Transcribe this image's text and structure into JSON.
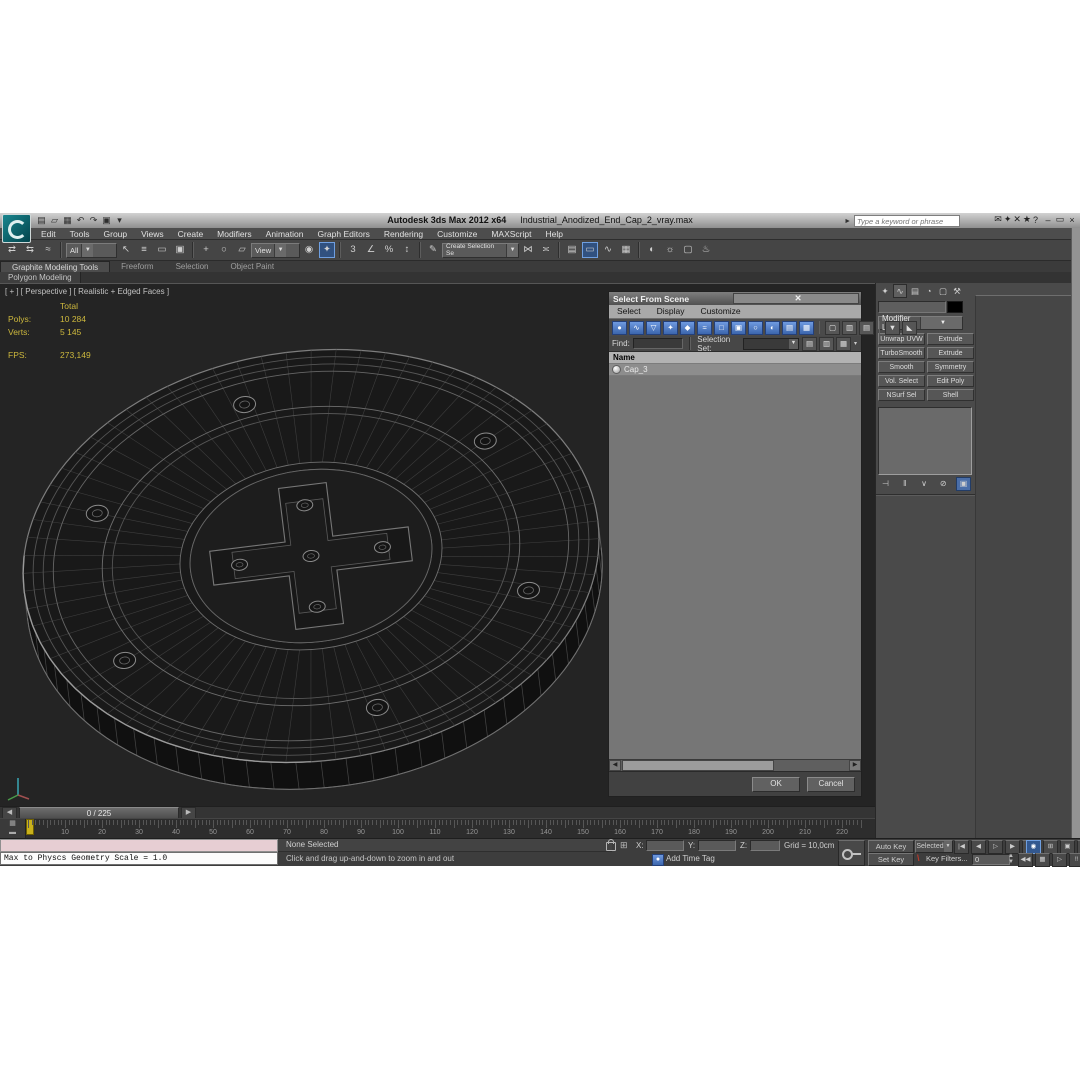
{
  "window": {
    "app_title": "Autodesk 3ds Max  2012 x64",
    "file_title": "Industrial_Anodized_End_Cap_2_vray.max",
    "search_placeholder": "Type a keyword or phrase"
  },
  "menubar": {
    "items": [
      "Edit",
      "Tools",
      "Group",
      "Views",
      "Create",
      "Modifiers",
      "Animation",
      "Graph Editors",
      "Rendering",
      "Customize",
      "MAXScript",
      "Help"
    ]
  },
  "toolbar": {
    "selection_filter": "All",
    "coord_system": "View",
    "named_sets": "Create Selection Se",
    "groups": [
      [
        {
          "n": "select-and-link-icon",
          "g": "⇄"
        },
        {
          "n": "unlink-selection-icon",
          "g": "⇆"
        },
        {
          "n": "bind-spacewarp-icon",
          "g": "≈"
        }
      ],
      [
        {
          "n": "select-object-icon",
          "g": "↖"
        },
        {
          "n": "select-by-name-icon",
          "g": "≡"
        },
        {
          "n": "rect-region-icon",
          "g": "▭"
        },
        {
          "n": "window-crossing-icon",
          "g": "▣"
        }
      ],
      [
        {
          "n": "select-move-icon",
          "g": "+"
        },
        {
          "n": "select-rotate-icon",
          "g": "○"
        },
        {
          "n": "select-scale-icon",
          "g": "▱"
        }
      ],
      [
        {
          "n": "use-center-icon",
          "g": "◉"
        },
        {
          "n": "select-manipulate-icon",
          "g": "✦",
          "active": true
        }
      ],
      [
        {
          "n": "snap-3d-icon",
          "g": "3"
        },
        {
          "n": "angle-snap-icon",
          "g": "∠"
        },
        {
          "n": "percent-snap-icon",
          "g": "%"
        },
        {
          "n": "spinner-snap-icon",
          "g": "↕"
        }
      ],
      [
        {
          "n": "edit-named-sets-icon",
          "g": "✎"
        }
      ],
      [
        {
          "n": "mirror-icon",
          "g": "⋈"
        },
        {
          "n": "align-icon",
          "g": "≍"
        }
      ],
      [
        {
          "n": "layer-manager-icon",
          "g": "▤"
        },
        {
          "n": "ribbon-toggle-icon",
          "g": "▭",
          "active": true
        },
        {
          "n": "curve-editor-icon",
          "g": "∿"
        },
        {
          "n": "schematic-view-icon",
          "g": "▦"
        }
      ],
      [
        {
          "n": "material-editor-icon",
          "g": "◐"
        },
        {
          "n": "render-setup-icon",
          "g": "☼"
        },
        {
          "n": "rendered-frame-icon",
          "g": "▢"
        },
        {
          "n": "render-production-icon",
          "g": "♨"
        }
      ]
    ],
    "qat_icons": [
      {
        "n": "new-scene-icon",
        "g": "▤"
      },
      {
        "n": "open-file-icon",
        "g": "▱"
      },
      {
        "n": "save-file-icon",
        "g": "▦"
      },
      {
        "n": "undo-icon",
        "g": "↶"
      },
      {
        "n": "redo-icon",
        "g": "↷"
      },
      {
        "n": "project-folder-icon",
        "g": "▣"
      },
      {
        "n": "qat-dropdown-icon",
        "g": "▾"
      }
    ],
    "search_icons": [
      {
        "n": "communication-center-icon",
        "g": "✉"
      },
      {
        "n": "wrench-icon",
        "g": "✦"
      },
      {
        "n": "sign-in-icon",
        "g": "✕"
      },
      {
        "n": "favorites-star-icon",
        "g": "★"
      },
      {
        "n": "help-icon",
        "g": "?"
      }
    ],
    "window_icons": [
      {
        "n": "minimize-icon",
        "g": "–"
      },
      {
        "n": "restore-icon",
        "g": "▭"
      },
      {
        "n": "close-icon",
        "g": "×"
      }
    ]
  },
  "ribbon": {
    "tabs": [
      "Graphite Modeling Tools",
      "Freeform",
      "Selection",
      "Object Paint"
    ],
    "active_tab": "Graphite Modeling Tools",
    "subtab": "Polygon Modeling",
    "collapse_icon": "▾"
  },
  "viewport": {
    "label": "[ + ] [ Perspective ] [ Realistic + Edged Faces ]",
    "stats": {
      "total": "Total",
      "polys_label": "Polys:",
      "polys": "10 284",
      "verts_label": "Verts:",
      "verts": "5 145",
      "fps_label": "FPS:",
      "fps": "273,149"
    }
  },
  "scene_dialog": {
    "title": "Select From Scene",
    "menus": [
      "Select",
      "Display",
      "Customize"
    ],
    "filter_icons": [
      {
        "n": "display-geometry-icon",
        "g": "●"
      },
      {
        "n": "display-shapes-icon",
        "g": "∿"
      },
      {
        "n": "display-lights-icon",
        "g": "▽"
      },
      {
        "n": "display-cameras-icon",
        "g": "✦"
      },
      {
        "n": "display-helpers-icon",
        "g": "◆"
      },
      {
        "n": "display-spacewarps-icon",
        "g": "≈"
      },
      {
        "n": "display-groups-icon",
        "g": "□"
      },
      {
        "n": "display-xrefs-icon",
        "g": "▣"
      },
      {
        "n": "display-bones-icon",
        "g": "○"
      },
      {
        "n": "display-containers-icon",
        "g": "◐"
      },
      {
        "n": "display-frozen-icon",
        "g": "▤"
      },
      {
        "n": "display-hidden-icon",
        "g": "▦"
      }
    ],
    "extra_icons": [
      {
        "n": "display-children-icon",
        "g": "▢"
      },
      {
        "n": "display-influences-icon",
        "g": "▥"
      },
      {
        "n": "display-dependents-icon",
        "g": "▤"
      }
    ],
    "funnel_icons": [
      {
        "n": "filter-icon",
        "g": "▼"
      },
      {
        "n": "filter-combinations-icon",
        "g": "◣"
      }
    ],
    "find_label": "Find:",
    "selection_set_label": "Selection Set:",
    "set_icons": [
      {
        "n": "create-set-icon",
        "g": "▤"
      },
      {
        "n": "add-to-set-icon",
        "g": "▥"
      },
      {
        "n": "subtract-set-icon",
        "g": "▦"
      }
    ],
    "expand_icon": "▾",
    "name_header": "Name",
    "rows": [
      {
        "label": "Cap_3"
      }
    ],
    "ok": "OK",
    "cancel": "Cancel",
    "hscroll_left": "◀",
    "hscroll_right": "▶"
  },
  "command_panel": {
    "tabs": [
      {
        "n": "create-tab-icon",
        "g": "✦"
      },
      {
        "n": "modify-tab-icon",
        "g": "∿",
        "active": true
      },
      {
        "n": "hierarchy-tab-icon",
        "g": "▤"
      },
      {
        "n": "motion-tab-icon",
        "g": "◔"
      },
      {
        "n": "display-tab-icon",
        "g": "▢"
      },
      {
        "n": "utilities-tab-icon",
        "g": "⚒"
      }
    ],
    "modifier_list": "Modifier List",
    "modifier_buttons": [
      "Unwrap UVW",
      "Extrude",
      "TurboSmooth",
      "Extrude",
      "Smooth",
      "Symmetry",
      "Vol. Select",
      "Edit Poly",
      "NSurf Sel",
      "Shell"
    ],
    "stack_icons": [
      {
        "n": "pin-stack-icon",
        "g": "⊣"
      },
      {
        "n": "show-end-result-icon",
        "g": "‖"
      },
      {
        "n": "make-unique-icon",
        "g": "∨"
      },
      {
        "n": "remove-modifier-icon",
        "g": "⊘"
      },
      {
        "n": "configure-sets-icon",
        "g": "▣",
        "blue": true
      }
    ]
  },
  "timeline": {
    "slider": "0 / 225",
    "prev_arrow": "◀",
    "next_arrow": "▶",
    "ticks": [
      10,
      20,
      30,
      40,
      50,
      60,
      70,
      80,
      90,
      100,
      110,
      120,
      130,
      140,
      150,
      160,
      170,
      180,
      190,
      200,
      210,
      220
    ]
  },
  "status": {
    "maxscript_line": "Max to Physcs Geometry Scale = 1.0",
    "selection": "None Selected",
    "prompt": "Click and drag up-and-down to zoom in and out",
    "x_label": "X:",
    "y_label": "Y:",
    "z_label": "Z:",
    "grid": "Grid = 10,0cm",
    "add_time_tag": "Add Time Tag",
    "auto_key": "Auto Key",
    "set_key": "Set Key",
    "key_mode": "Selected",
    "key_filters": "Key Filters...",
    "frame": "0",
    "playback_icons": [
      {
        "n": "go-start-icon",
        "g": "|◀"
      },
      {
        "n": "prev-frame-icon",
        "g": "◀"
      },
      {
        "n": "play-icon",
        "g": "▷"
      },
      {
        "n": "next-frame-icon",
        "g": "▶"
      },
      {
        "n": "go-end-icon",
        "g": "▶|"
      }
    ],
    "nav_icons": [
      {
        "n": "zoom-icon",
        "g": "◉",
        "blue": true
      },
      {
        "n": "zoom-all-icon",
        "g": "⊞"
      },
      {
        "n": "zoom-extents-icon",
        "g": "▣"
      },
      {
        "n": "zoom-region-icon",
        "g": "▢"
      }
    ],
    "nav2_icons": [
      {
        "n": "key-mode-icon",
        "g": "◀◀"
      },
      {
        "n": "time-config-icon",
        "g": "▦"
      },
      {
        "n": "pan-icon",
        "g": "▷"
      },
      {
        "n": "orbit-icon",
        "g": "‼"
      },
      {
        "n": "maximize-viewport-icon",
        "g": "▢"
      }
    ]
  },
  "colors": {
    "accent_blue": "#4a7fd6",
    "stats_yellow": "#cdb83d",
    "marker_yellow": "#c9b11c",
    "listener_pink": "#e7ced3"
  }
}
